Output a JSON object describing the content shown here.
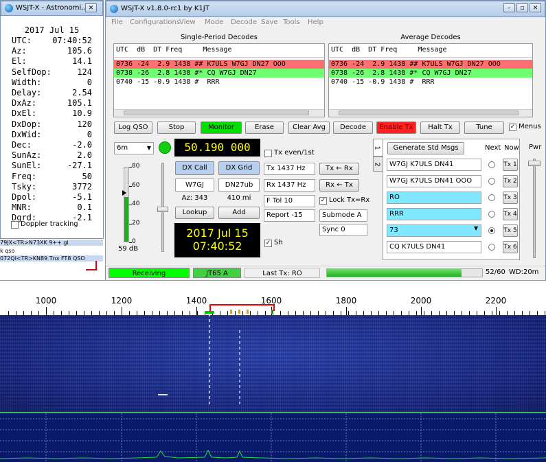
{
  "astro": {
    "title": "WSJT-X - Astronomi...",
    "date": "2017 Jul 15",
    "rows": [
      {
        "label": "UTC:",
        "value": "07:40:52"
      },
      {
        "label": "Az:",
        "value": "105.6"
      },
      {
        "label": "El:",
        "value": "14.1"
      },
      {
        "label": "SelfDop:",
        "value": "124"
      },
      {
        "label": "Width:",
        "value": "0"
      },
      {
        "label": "Delay:",
        "value": "2.54"
      },
      {
        "label": "DxAz:",
        "value": "105.1"
      },
      {
        "label": "DxEl:",
        "value": "10.9"
      },
      {
        "label": "DxDop:",
        "value": "120"
      },
      {
        "label": "DxWid:",
        "value": "0"
      },
      {
        "label": "Dec:",
        "value": "-2.0"
      },
      {
        "label": "SunAz:",
        "value": "2.0"
      },
      {
        "label": "SunEl:",
        "value": "-27.1"
      },
      {
        "label": "Freq:",
        "value": "50"
      },
      {
        "label": "Tsky:",
        "value": "3772"
      },
      {
        "label": "Dpol:",
        "value": "-5.1"
      },
      {
        "label": "MNR:",
        "value": "0.1"
      },
      {
        "label": "Dgrd:",
        "value": "-2.1"
      }
    ],
    "doppler_label": "Doppler tracking",
    "doppler_checked": false
  },
  "underlay": {
    "line1": "79JX<TR>N73XK 9++ gl",
    "line2": "k qso",
    "line3": "072QI<TR>KN89 Tnx FT8 QSO"
  },
  "main": {
    "title": "WSJT-X  v1.8.0-rc1  by K1JT",
    "menu": [
      "File",
      "Configurations",
      "View",
      "Mode",
      "Decode",
      "Save",
      "Tools",
      "Help"
    ],
    "single_heading": "Single-Period Decodes",
    "average_heading": "Average Decodes",
    "col_header": "UTC  dB  DT Freq     Message",
    "decodes": [
      {
        "text": "0736 -24  2.9 1438 ## K7ULS W7GJ DN27 OOO",
        "bg": "#ff7070"
      },
      {
        "text": "0738 -26  2.8 1438 #* CQ W7GJ DN27",
        "bg": "#70ff70"
      },
      {
        "text": "0740 -15 -0.9 1438 #  RRR",
        "bg": "#ffffff"
      }
    ],
    "avg_decodes": [
      {
        "text": "0736 -24  2.9 1438 ## K7ULS W7GJ DN27 OOO",
        "bg": "#ff7070"
      },
      {
        "text": "0738 -26  2.8 1438 #* CQ W7GJ DN27",
        "bg": "#70ff70"
      },
      {
        "text": "0740 -15 -0.9 1438 #  RRR",
        "bg": "#ffffff"
      }
    ],
    "buttons": {
      "log_qso": "Log QSO",
      "stop": "Stop",
      "monitor": "Monitor",
      "erase": "Erase",
      "clear_avg": "Clear Avg",
      "decode": "Decode",
      "enable_tx": "Enable Tx",
      "halt_tx": "Halt Tx",
      "tune": "Tune",
      "menus": "Menus"
    },
    "band": "6m",
    "frequency": "50.190 000",
    "dx_call_btn": "DX Call",
    "dx_grid_btn": "DX Grid",
    "dx_call": "W7GJ",
    "dx_grid": "DN27ub",
    "az": "Az: 343",
    "distance": "410 mi",
    "lookup": "Lookup",
    "add": "Add",
    "clock_date": "2017 Jul 15",
    "clock_time": "07:40:52",
    "meter_ticks": [
      "80",
      "60",
      "40",
      "20",
      "0"
    ],
    "meter_db": "59 dB",
    "meter_level": 0.6,
    "tx_even": "Tx even/1st",
    "tx_freq": "Tx  1437  Hz",
    "rx_freq": "Rx  1437  Hz",
    "tx_from_rx": "Tx ← Rx",
    "rx_from_tx": "Rx ← Tx",
    "ftol": "F Tol  10",
    "lock": "Lock Tx=Rx",
    "report": "Report -15",
    "submode": "Submode A",
    "sync": "Sync   0",
    "sh": "Sh",
    "tab1": "1",
    "tab2": "2",
    "gen_std": "Generate Std Msgs",
    "next": "Next",
    "now": "Now",
    "pwr": "Pwr",
    "msgs": [
      {
        "text": "W7GJ K7ULS DN41",
        "btn": "Tx 1",
        "bg": "#ffffff",
        "selected": false
      },
      {
        "text": "W7GJ K7ULS DN41 OOO",
        "btn": "Tx 2",
        "bg": "#ffffff",
        "selected": false
      },
      {
        "text": "RO",
        "btn": "Tx 3",
        "bg": "#80e8ff",
        "selected": false
      },
      {
        "text": "RRR",
        "btn": "Tx 4",
        "bg": "#80e8ff",
        "selected": false
      },
      {
        "text": "73",
        "btn": "Tx 5",
        "bg": "#80e8ff",
        "selected": true
      },
      {
        "text": "CQ K7ULS DN41",
        "btn": "Tx 6",
        "bg": "#ffffff",
        "selected": false
      }
    ],
    "status": {
      "state": "Receiving",
      "mode": "JT65 A",
      "last_tx": "Last Tx: RO",
      "progress": "52/60",
      "progress_fraction": 0.867,
      "wd": "WD:20m"
    }
  },
  "waterfall": {
    "ticks": [
      "1000",
      "1200",
      "1400",
      "1600",
      "1800",
      "2000",
      "2200"
    ]
  }
}
